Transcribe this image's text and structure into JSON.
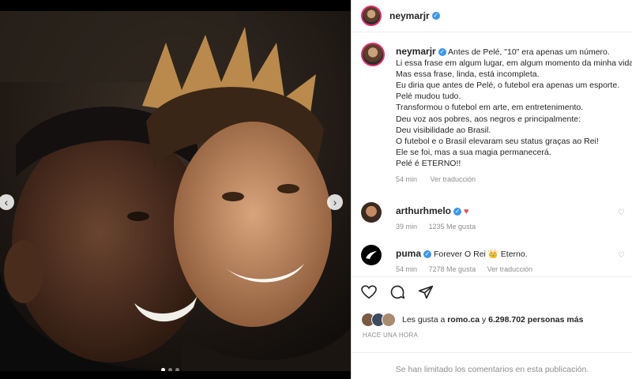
{
  "post": {
    "username": "neymarjr",
    "caption_lines": [
      "Antes de Pelé, \"10\" era apenas um número.",
      "Li essa frase em algum lugar, em algum momento da minha vida.",
      "Mas essa frase, linda, está incompleta.",
      "Eu diria que antes de Pelé, o futebol era apenas um esporte.",
      "Pelé mudou tudo.",
      "Transformou o futebol em arte, em entretenimento.",
      "Deu voz aos pobres, aos negros e principalmente:",
      "Deu visibilidade ao Brasil.",
      "O futebol e o Brasil elevaram seu status graças ao Rei!",
      "Ele se foi, mas a sua magia permanecerá.",
      "Pelé é ETERNO!!"
    ],
    "caption_time": "54 min",
    "caption_translate": "Ver traducción"
  },
  "comments": [
    {
      "username": "arthurhmelo",
      "text": "",
      "emoji": "♥",
      "time": "39 min",
      "likes": "1235 Me gusta",
      "translate": ""
    },
    {
      "username": "puma",
      "text": "Forever O Rei",
      "emoji": "👑",
      "suffix": "Eterno.",
      "time": "54 min",
      "likes": "7278 Me gusta",
      "translate": "Ver traducción"
    }
  ],
  "likes_line": {
    "prefix": "Les gusta a",
    "user": "romo.ca",
    "middle": "y",
    "count": "6.298.702 personas más"
  },
  "timestamp": "HACE UNA HORA",
  "comments_limited": "Se han limitado los comentarios en esta publicación.",
  "colors": {
    "verified": "#3897f0",
    "heart": "#ed4956",
    "muted": "#8e8e8e"
  },
  "icons": {
    "like": "heart-outline",
    "comment": "speech-bubble",
    "share": "paper-plane",
    "prev": "chevron-left",
    "next": "chevron-right"
  }
}
